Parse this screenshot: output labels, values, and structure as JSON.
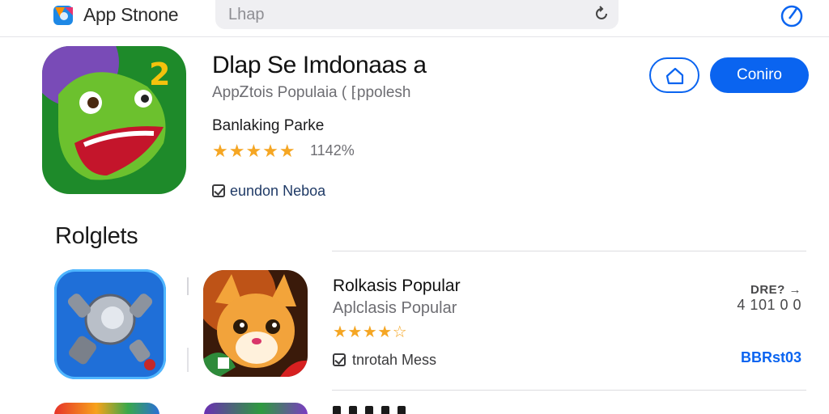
{
  "header": {
    "store_title": "App Stnone",
    "search_text": "Lhap",
    "icons": [
      "app-store-logo-icon",
      "reload-icon",
      "compass-icon"
    ]
  },
  "featured": {
    "title": "Dlap Se Imdonaas a",
    "subtitle": "AppᏃtois Populaia ( ⁅ppolesh",
    "developer": "Banlaking Parke",
    "stars": "★★★★★",
    "rating_value": 5,
    "rating_count": "1142%",
    "note": "eundon Neboa",
    "home_button_icon": "home-icon",
    "confirm_label": "Coniro",
    "app_icon": "cartoon-creature-2-icon"
  },
  "section": {
    "title": "Rolglets"
  },
  "apps": [
    {
      "name": "Rolkasis Popular",
      "subtitle": "Aplclasis Popular",
      "stars": "★★★★☆",
      "rating_value": 4.5,
      "note": "tnrotah Mess",
      "meta_line1": "DRE? →",
      "meta_line2": "4 101 0 0",
      "get_label": "BBRst03",
      "icon": "robot-gadget-icon"
    },
    {
      "icon": "cartoon-fox-icon"
    }
  ],
  "colors": {
    "accent": "#0a64f0",
    "star": "#f5a623",
    "text_secondary": "#6e6e73"
  }
}
